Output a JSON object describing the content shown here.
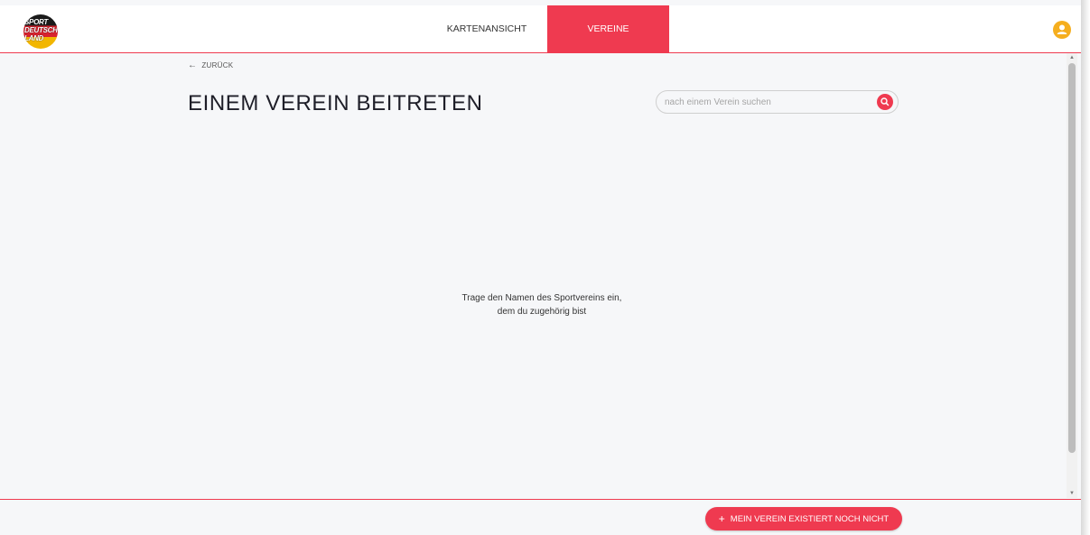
{
  "header": {
    "logo_lines": [
      "SPORT",
      "DEUTSCH",
      "LAND"
    ],
    "nav": [
      {
        "label": "KARTENANSICHT",
        "active": false
      },
      {
        "label": "VEREINE",
        "active": true
      }
    ],
    "user_icon": "user-avatar-icon"
  },
  "back": {
    "label": "ZURÜCK",
    "icon": "arrow-left-icon"
  },
  "page_title": "EINEM VEREIN BEITRETEN",
  "search": {
    "placeholder": "nach einem Verein suchen",
    "value": "",
    "icon": "search-icon"
  },
  "hint": {
    "line1": "Trage den Namen des Sportvereins ein,",
    "line2": "dem du zugehörig bist"
  },
  "footer": {
    "create_label": "MEIN VEREIN EXISTIERT NOCH NICHT",
    "create_icon": "plus-icon"
  },
  "colors": {
    "accent": "#ef3a50",
    "user": "#f5ae1e",
    "background": "#f6f7f9"
  }
}
